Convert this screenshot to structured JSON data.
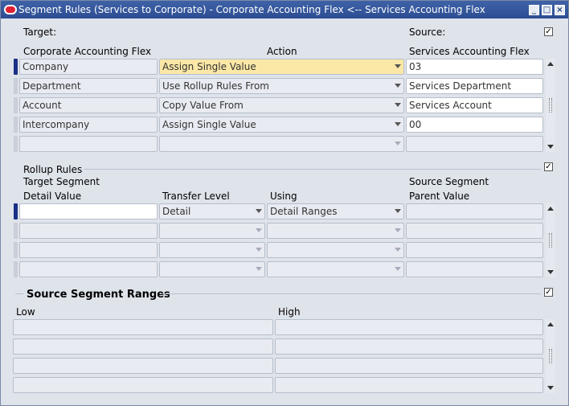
{
  "window": {
    "title": "Segment Rules (Services to Corporate) - Corporate Accounting Flex <-- Services Accounting Flex"
  },
  "target_label": "Target:",
  "source_label": "Source:",
  "source_checked": true,
  "columns": {
    "target": "Corporate Accounting Flex",
    "action": "Action",
    "source": "Services Accounting Flex"
  },
  "segments": [
    {
      "target": "Company",
      "action": "Assign Single Value",
      "source": "03"
    },
    {
      "target": "Department",
      "action": "Use Rollup Rules From",
      "source": "Services Department"
    },
    {
      "target": "Account",
      "action": "Copy Value From",
      "source": "Services Account"
    },
    {
      "target": "Intercompany",
      "action": "Assign Single Value",
      "source": "00"
    },
    {
      "target": "",
      "action": "",
      "source": ""
    }
  ],
  "rollup": {
    "title": "Rollup Rules",
    "checked": true,
    "col_target_1": "Target Segment",
    "col_target_2": "Detail Value",
    "col_transfer": "Transfer Level",
    "col_using": "Using",
    "col_source_1": "Source Segment",
    "col_source_2": "Parent Value",
    "rows": [
      {
        "detail": "",
        "transfer": "Detail",
        "using": "Detail Ranges",
        "parent": ""
      },
      {
        "detail": "",
        "transfer": "",
        "using": "",
        "parent": ""
      },
      {
        "detail": "",
        "transfer": "",
        "using": "",
        "parent": ""
      },
      {
        "detail": "",
        "transfer": "",
        "using": "",
        "parent": ""
      }
    ]
  },
  "ranges": {
    "title": "Source Segment Ranges",
    "checked": true,
    "col_low": "Low",
    "col_high": "High",
    "rows": [
      {
        "low": "",
        "high": ""
      },
      {
        "low": "",
        "high": ""
      },
      {
        "low": "",
        "high": ""
      },
      {
        "low": "",
        "high": ""
      }
    ]
  }
}
